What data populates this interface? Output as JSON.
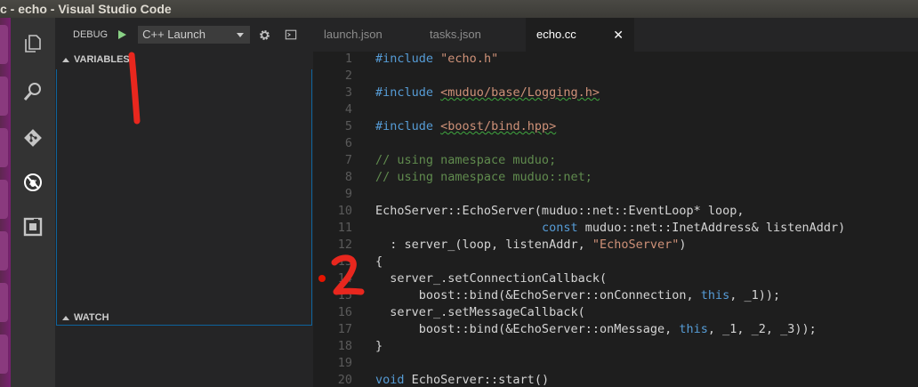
{
  "window": {
    "title": "c - echo - Visual Studio Code"
  },
  "debug": {
    "label": "DEBUG",
    "configuration": "C++ Launch"
  },
  "sections": {
    "variables": "VARIABLES",
    "watch": "WATCH"
  },
  "tabs": [
    {
      "label": "launch.json",
      "active": false
    },
    {
      "label": "tasks.json",
      "active": false
    },
    {
      "label": "echo.cc",
      "active": true,
      "close": "✕"
    }
  ],
  "editor": {
    "breakpoint_line": 14,
    "lines": [
      {
        "n": "1",
        "text": "#include \"echo.h\""
      },
      {
        "n": "2",
        "text": ""
      },
      {
        "n": "3",
        "text": "#include <muduo/base/Logging.h>"
      },
      {
        "n": "4",
        "text": ""
      },
      {
        "n": "5",
        "text": "#include <boost/bind.hpp>"
      },
      {
        "n": "6",
        "text": ""
      },
      {
        "n": "7",
        "text": "// using namespace muduo;"
      },
      {
        "n": "8",
        "text": "// using namespace muduo::net;"
      },
      {
        "n": "9",
        "text": ""
      },
      {
        "n": "10",
        "text": "EchoServer::EchoServer(muduo::net::EventLoop* loop,"
      },
      {
        "n": "11",
        "text": "                       const muduo::net::InetAddress& listenAddr)"
      },
      {
        "n": "12",
        "text": "  : server_(loop, listenAddr, \"EchoServer\")"
      },
      {
        "n": "13",
        "text": "{"
      },
      {
        "n": "14",
        "text": "  server_.setConnectionCallback("
      },
      {
        "n": "15",
        "text": "      boost::bind(&EchoServer::onConnection, this, _1));"
      },
      {
        "n": "16",
        "text": "  server_.setMessageCallback("
      },
      {
        "n": "17",
        "text": "      boost::bind(&EchoServer::onMessage, this, _1, _2, _3));"
      },
      {
        "n": "18",
        "text": "}"
      },
      {
        "n": "19",
        "text": ""
      },
      {
        "n": "20",
        "text": "void EchoServer::start()"
      }
    ]
  },
  "colors": {
    "accent": "#0e639c",
    "breakpoint": "#e51400",
    "play": "#89d185",
    "annotation": "#e8271e"
  },
  "icons": {
    "activity": [
      "explorer-icon",
      "search-icon",
      "git-icon",
      "debug-icon",
      "extensions-icon"
    ],
    "toolbar": [
      "play-icon",
      "gear-icon",
      "console-icon"
    ]
  }
}
